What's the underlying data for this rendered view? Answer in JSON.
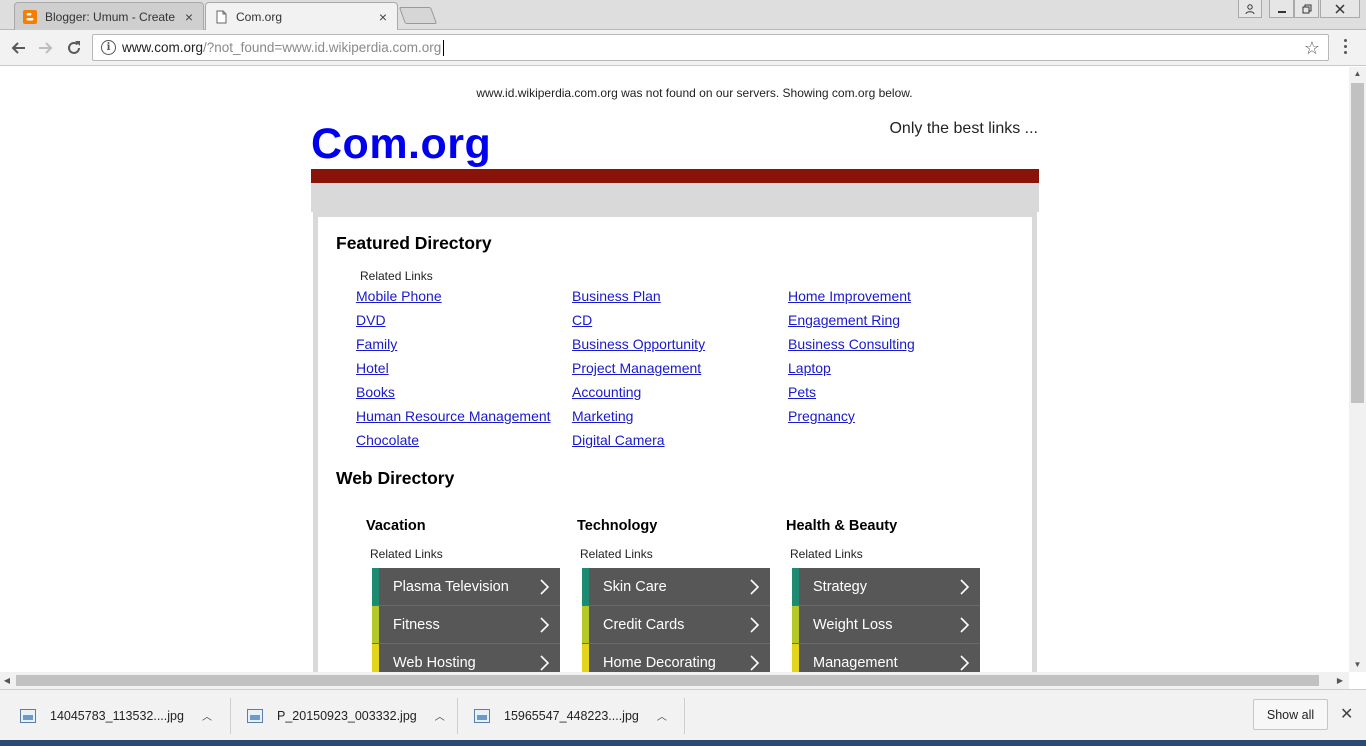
{
  "browser": {
    "tabs": [
      {
        "title": "Blogger: Umum - Create",
        "close": "×",
        "favicon": "blogger-icon"
      },
      {
        "title": "Com.org",
        "close": "×",
        "favicon": "page-icon"
      }
    ],
    "url_host": "www.com.org",
    "url_rest": "/?not_found=www.id.wikiperdia.com.org",
    "star": "☆"
  },
  "page": {
    "notice": "www.id.wikiperdia.com.org was not found on our servers. Showing com.org below.",
    "logo": "Com.org",
    "tagline": "Only the best links ...",
    "featured_heading": "Featured Directory",
    "related_label": "Related Links",
    "featured_links": [
      [
        "Mobile Phone",
        "DVD",
        "Family",
        "Hotel",
        "Books",
        "Human Resource Management",
        "Chocolate"
      ],
      [
        "Business Plan",
        "CD",
        "Business Opportunity",
        "Project Management",
        "Accounting",
        "Marketing",
        "Digital Camera"
      ],
      [
        "Home Improvement",
        "Engagement Ring",
        "Business Consulting",
        "Laptop",
        "Pets",
        "Pregnancy"
      ]
    ],
    "web_heading": "Web Directory",
    "categories": [
      {
        "title": "Vacation",
        "related": "Related Links",
        "items": [
          "Plasma Television",
          "Fitness",
          "Web Hosting"
        ]
      },
      {
        "title": "Technology",
        "related": "Related Links",
        "items": [
          "Skin Care",
          "Credit Cards",
          "Home Decorating"
        ]
      },
      {
        "title": "Health & Beauty",
        "related": "Related Links",
        "items": [
          "Strategy",
          "Weight Loss",
          "Management"
        ]
      }
    ],
    "stripe_colors": [
      "#1e8a72",
      "#b4c928",
      "#e3d41c"
    ],
    "accent_red": "#8a1309",
    "logo_color": "#0000ee"
  },
  "downloads": {
    "items": [
      {
        "name": "14045783_113532....jpg"
      },
      {
        "name": "P_20150923_003332.jpg"
      },
      {
        "name": "15965547_448223....jpg"
      }
    ],
    "show_all": "Show all",
    "close": "✕"
  }
}
